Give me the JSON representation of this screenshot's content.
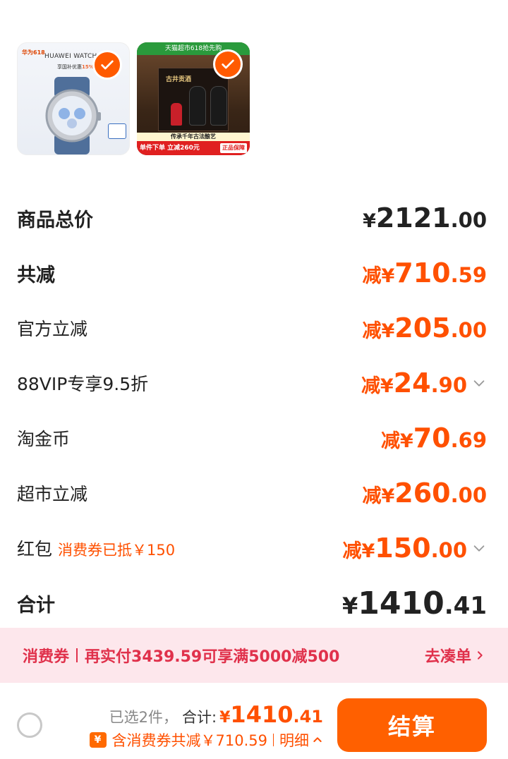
{
  "products": [
    {
      "kind": "watch",
      "selected": true,
      "brand_tag": "华为618",
      "title": "HUAWEI WATCH GT",
      "subtitle": "享国补优惠",
      "discount": "15%"
    },
    {
      "kind": "liquor",
      "selected": true,
      "top_banner": "天猫超市618抢先购",
      "box_label": "古井贡酒",
      "strip": "传承千年古法酿艺",
      "promo": "单件下单 立减260元",
      "promo_tag": "正品保障"
    }
  ],
  "summary": {
    "total": {
      "label": "商品总价",
      "prefix": "¥",
      "int": "2121",
      "dec": ".00"
    },
    "discount_total": {
      "label": "共减",
      "prefix": "减¥",
      "int": "710",
      "dec": ".59"
    },
    "items": [
      {
        "label": "官方立减",
        "prefix": "减¥",
        "int": "205",
        "dec": ".00",
        "has_chevron": false,
        "note": ""
      },
      {
        "label": "88VIP专享9.5折",
        "prefix": "减¥",
        "int": "24",
        "dec": ".90",
        "has_chevron": true,
        "note": ""
      },
      {
        "label": "淘金币",
        "prefix": "减¥",
        "int": "70",
        "dec": ".69",
        "has_chevron": false,
        "note": ""
      },
      {
        "label": "超市立减",
        "prefix": "减¥",
        "int": "260",
        "dec": ".00",
        "has_chevron": false,
        "note": ""
      },
      {
        "label": "红包",
        "prefix": "减¥",
        "int": "150",
        "dec": ".00",
        "has_chevron": true,
        "note": "消费券已抵￥150"
      }
    ],
    "grand_total": {
      "label": "合计",
      "prefix": "¥",
      "int": "1410",
      "dec": ".41"
    }
  },
  "banner": {
    "tag": "消费券",
    "text": "再实付3439.59可享满5000减500",
    "link": "去凑单"
  },
  "footer": {
    "selected": "已选2件，",
    "sum_label": "合计:",
    "sum_prefix": "¥",
    "sum_int": "1410",
    "sum_dec": ".41",
    "coupon_icon": "¥",
    "coupon_text": "含消费券共减￥710.59",
    "detail": "明细",
    "checkout": "结算"
  },
  "colors": {
    "accent": "#ff5000",
    "button": "#ff6000",
    "banner_bg": "#fde7ec",
    "banner_text": "#e0314b"
  }
}
